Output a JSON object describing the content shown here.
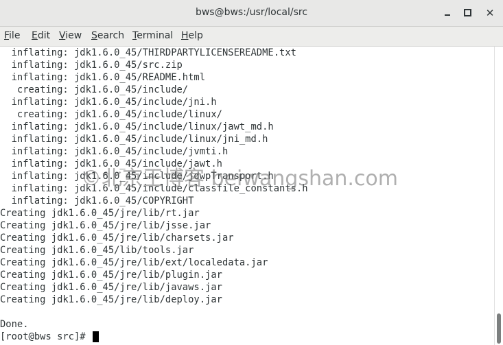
{
  "window": {
    "title": "bws@bws:/usr/local/src",
    "controls": {
      "minimize": "minimize",
      "maximize": "maximize",
      "close": "✕"
    }
  },
  "menubar": {
    "items": [
      {
        "underline": "F",
        "rest": "ile"
      },
      {
        "underline": "E",
        "rest": "dit"
      },
      {
        "underline": "V",
        "rest": "iew"
      },
      {
        "underline": "S",
        "rest": "earch"
      },
      {
        "underline": "T",
        "rest": "erminal"
      },
      {
        "underline": "H",
        "rest": "elp"
      }
    ]
  },
  "terminal": {
    "lines": [
      "  inflating: jdk1.6.0_45/THIRDPARTYLICENSEREADME.txt",
      "  inflating: jdk1.6.0_45/src.zip",
      "  inflating: jdk1.6.0_45/README.html",
      "   creating: jdk1.6.0_45/include/",
      "  inflating: jdk1.6.0_45/include/jni.h",
      "   creating: jdk1.6.0_45/include/linux/",
      "  inflating: jdk1.6.0_45/include/linux/jawt_md.h",
      "  inflating: jdk1.6.0_45/include/linux/jni_md.h",
      "  inflating: jdk1.6.0_45/include/jvmti.h",
      "  inflating: jdk1.6.0_45/include/jawt.h",
      "  inflating: jdk1.6.0_45/include/jdwpTransport.h",
      "  inflating: jdk1.6.0_45/include/classfile_constants.h",
      "  inflating: jdk1.6.0_45/COPYRIGHT",
      "Creating jdk1.6.0_45/jre/lib/rt.jar",
      "Creating jdk1.6.0_45/jre/lib/jsse.jar",
      "Creating jdk1.6.0_45/jre/lib/charsets.jar",
      "Creating jdk1.6.0_45/lib/tools.jar",
      "Creating jdk1.6.0_45/jre/lib/ext/localedata.jar",
      "Creating jdk1.6.0_45/jre/lib/plugin.jar",
      "Creating jdk1.6.0_45/jre/lib/javaws.jar",
      "Creating jdk1.6.0_45/jre/lib/deploy.jar",
      "",
      "Done."
    ],
    "prompt": "[root@bws src]# "
  },
  "watermark": "©北京王博客 beiwangshan.com"
}
